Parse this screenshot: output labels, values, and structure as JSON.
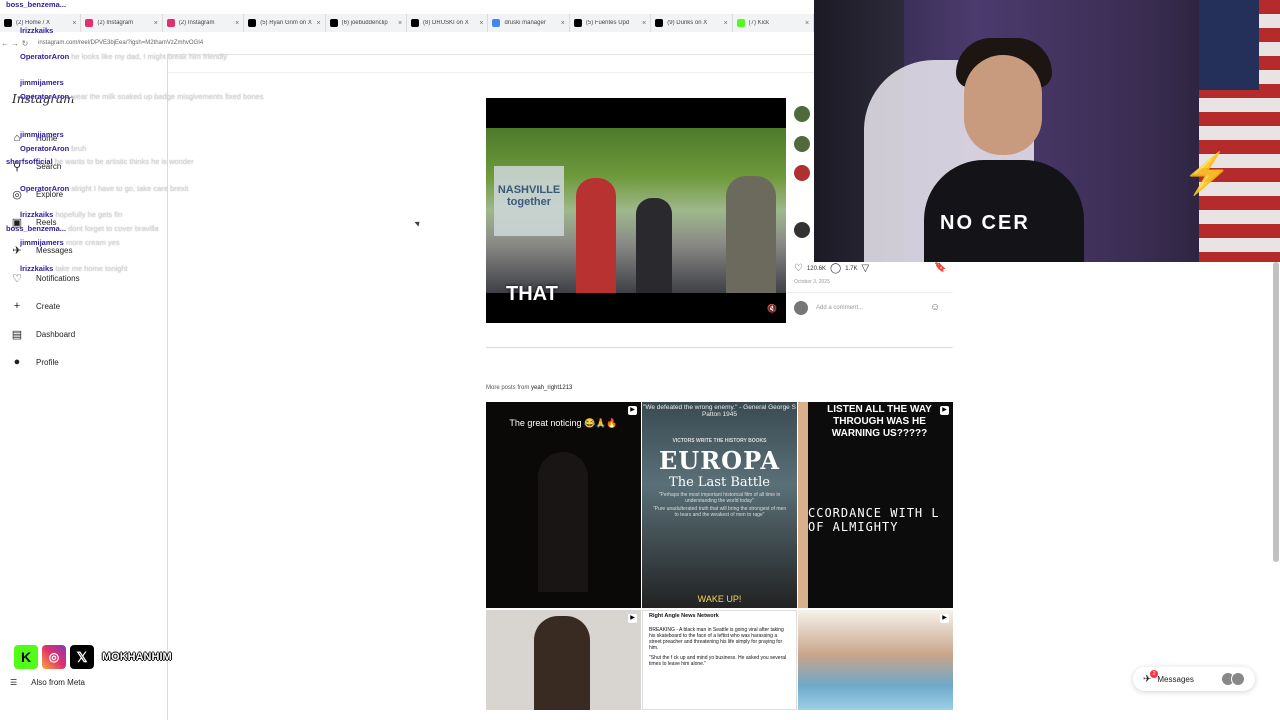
{
  "browser": {
    "tabs": [
      {
        "label": "(2) Home / X",
        "color": "#000000"
      },
      {
        "label": "(2) Instagram",
        "color": "#e1306c"
      },
      {
        "label": "(2) Instagram",
        "color": "#e1306c"
      },
      {
        "label": "(5) Ryan Grim on X",
        "color": "#000000"
      },
      {
        "label": "(6) joebuddenclip",
        "color": "#000000"
      },
      {
        "label": "(8) DRUSKI on X",
        "color": "#000000"
      },
      {
        "label": "druski manager",
        "color": "#4285f4"
      },
      {
        "label": "(5) Fuentes Upd",
        "color": "#000000"
      },
      {
        "label": "(9) Dunks on X",
        "color": "#000000"
      },
      {
        "label": "(7) Kick",
        "color": "#53fc18"
      }
    ],
    "url": "instagram.com/reel/DPVE3bjEea/?igsh=M2thamVzZmhvOGI4"
  },
  "sidebar": {
    "logo": "Instagram",
    "items": [
      {
        "label": "Home",
        "icon": "home-icon",
        "glyph": "⌂"
      },
      {
        "label": "Search",
        "icon": "search-icon",
        "glyph": "⚲"
      },
      {
        "label": "Explore",
        "icon": "explore-icon",
        "glyph": "◎"
      },
      {
        "label": "Reels",
        "icon": "reels-icon",
        "glyph": "▣"
      },
      {
        "label": "Messages",
        "icon": "messages-icon",
        "glyph": "✈"
      },
      {
        "label": "Notifications",
        "icon": "heart-icon",
        "glyph": "♡"
      },
      {
        "label": "Create",
        "icon": "plus-icon",
        "glyph": "+"
      },
      {
        "label": "Dashboard",
        "icon": "dashboard-icon",
        "glyph": "▤"
      },
      {
        "label": "Profile",
        "icon": "avatar-icon",
        "glyph": "●"
      }
    ],
    "also_from_meta": "Also from Meta"
  },
  "chat": [
    {
      "user": "boss_benzema...",
      "msg": ""
    },
    {
      "user": "lrizzkaiks",
      "msg": ""
    },
    {
      "user": "OperatorAron",
      "msg": "he looks like my dad, I might break him friendly"
    },
    {
      "user": "jimmijamers",
      "msg": ""
    },
    {
      "user": "OperatorAron",
      "msg": "wear the milk soaked up badge misgivements fixed bones"
    },
    {
      "user": "jimmijamers",
      "msg": ""
    },
    {
      "user": "OperatorAron",
      "msg": "bruh"
    },
    {
      "user": "sherfsofficial",
      "msg": "he wants to be artistic thinks he is wonder"
    },
    {
      "user": "OperatorAron",
      "msg": "alright I have to go, take care brexit"
    },
    {
      "user": "lrizzkaiks",
      "msg": "hopefully he gets fin"
    },
    {
      "user": "boss_benzema...",
      "msg": "dont forget to cover bravilla"
    },
    {
      "user": "jimmijamers",
      "msg": "more cream yes"
    },
    {
      "user": "lrizzkaiks",
      "msg": "take me home tonight"
    }
  ],
  "post": {
    "video_caption": "THAT",
    "banner_text": "NASHVILLE together",
    "likes": "120.6K",
    "comments": "1.7K",
    "date": "October 3, 2025",
    "add_comment_placeholder": "Add a comment...",
    "avatar_colors": [
      "#4f6b3a",
      "#4f6b3a",
      "#b03030",
      "#333333"
    ]
  },
  "more_posts": {
    "prefix": "More posts from",
    "username": "yeah_right1213"
  },
  "grid": {
    "t1_text": "The great noticing 😂🙏🔥",
    "t2_quote": "\"We defeated the wrong enemy.\" - General George S Patton 1945",
    "t2_tag": "VICTORS WRITE THE HISTORY BOOKS",
    "t2_title": "EUROPA",
    "t2_sub": "The Last Battle",
    "t2_small1": "\"Perhaps the most important historical film of all time in understanding the world today\"",
    "t2_small2": "\"Pure unadulterated truth that will bring the strongest of men to tears and the weakest of men to rage\"",
    "t2_wake": "WAKE UP!",
    "t3_header": "LISTEN ALL THE WAY THROUGH WAS HE WARNING US?????",
    "t3_mid": "CCORDANCE WITH L OF ALMIGHTY",
    "t5_source": "Right Angle News Network",
    "t5_p1": "BREAKING - A black man in Seattle is going viral after taking his skateboard to the face of a leftist who was harassing a street preacher and threatening his life simply for praying for him.",
    "t5_p2": "\"Shut the f ck up and mind yo business. He asked you several times to leave him alone.\""
  },
  "messages_pill": {
    "label": "Messages",
    "badge": "2"
  },
  "stream": {
    "shirt_text": "NO CER",
    "handle": "MOKHANHIM"
  }
}
